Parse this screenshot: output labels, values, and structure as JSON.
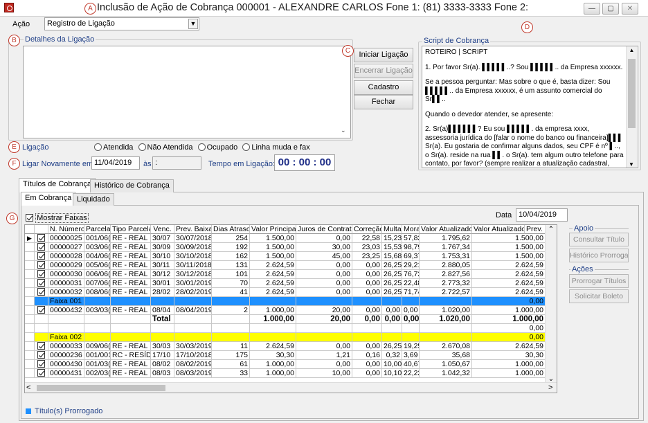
{
  "window": {
    "title": "Inclusão de Ação de Cobrança   000001 - ALEXANDRE CARLOS  Fone 1: (81) 3333-3333 Fone 2:",
    "markers": [
      "A",
      "B",
      "C",
      "D",
      "E",
      "F",
      "G"
    ]
  },
  "acao": {
    "label": "Ação",
    "value": "Registro de Ligação"
  },
  "detalhes": {
    "title": "Detalhes da Ligação",
    "value": ""
  },
  "buttons": {
    "iniciar": "Iniciar Ligação",
    "encerrar": "Encerrar Ligação",
    "cadastro": "Cadastro",
    "fechar": "Fechar"
  },
  "script": {
    "title": "Script de Cobrança",
    "lines": [
      "ROTEIRO | SCRIPT",
      "1. Por favor Sr(a). ▌▌▌▌▌..? Sou ▌▌▌▌▌.. da Empresa xxxxxx.",
      "Se a pessoa perguntar: Mas sobre o que é, basta dizer: Sou ▌▌▌▌▌.. da Empresa xxxxxx, é um assunto comercial do Sr▌▌..",
      "Quando o devedor atender, se apresente:",
      "2. Sr(a)▌▌▌▌▌▌? Eu sou ▌▌▌▌▌. da empresa xxxx, assessoria jurídica do [falar o nome do banco ou financeira]▌▌▌ Sr(a). Eu gostaria de confirmar alguns dados, seu CPF é nº ▌.., o Sr(a). reside na rua ▌▌. o Sr(a). tem algum outro telefone para contato, por favor? (sempre realizar a atualização cadastral, assim, caso precise"
    ]
  },
  "ligacao": {
    "label": "Ligação",
    "options": [
      "Atendida",
      "Não Atendida",
      "Ocupado",
      "Linha muda e fax"
    ],
    "ligar_label": "Ligar Novamente em:",
    "ligar_date": "11/04/2019",
    "as_label": "às",
    "ligar_time": ":",
    "tempo_label": "Tempo em Ligação:",
    "tempo_value": "00 : 00 : 00"
  },
  "tabs": {
    "titulos": "Títulos de Cobrança",
    "historico": "Histórico de Cobrança",
    "em_cobranca": "Em Cobrança",
    "liquidado": "Liquidado"
  },
  "grid": {
    "mostrar_faixas": "Mostrar Faixas",
    "data_label": "Data",
    "data_value": "10/04/2019",
    "columns": [
      "N. Número",
      "Parcela",
      "Tipo Parcela",
      "Venc.",
      "Prev. Baixa",
      "Dias Atraso",
      "Valor Principal",
      "Juros de Contrato",
      "Correção",
      "Multa",
      "Mora",
      "Valor Atualizado",
      "Valor Atualizado(",
      "Prev. Baixa"
    ],
    "rows": [
      {
        "kind": "data",
        "mark": "▶",
        "cells": [
          "00000025",
          "001/06(",
          "RE - REAL",
          "30/07",
          "30/07/2018",
          "254",
          "1.500,00",
          "0,00",
          "22,58",
          "15,23",
          "57,82",
          "1.795,62",
          "1.500,00"
        ]
      },
      {
        "kind": "data",
        "mark": "",
        "cells": [
          "00000027",
          "003/06(",
          "RE - REAL",
          "30/09",
          "30/09/2018",
          "192",
          "1.500,00",
          "30,00",
          "23,03",
          "15,53",
          "98,79",
          "1.767,34",
          "1.500,00"
        ]
      },
      {
        "kind": "data",
        "mark": "",
        "cells": [
          "00000028",
          "004/06(",
          "RE - REAL",
          "30/10",
          "30/10/2018",
          "162",
          "1.500,00",
          "45,00",
          "23,25",
          "15,68",
          "69,37",
          "1.753,31",
          "1.500,00"
        ]
      },
      {
        "kind": "data",
        "mark": "",
        "cells": [
          "00000029",
          "005/06(",
          "RE - REAL",
          "30/11",
          "30/11/2018",
          "131",
          "2.624,59",
          "0,00",
          "0,00",
          "26,25",
          "29,21",
          "2.880,05",
          "2.624,59"
        ]
      },
      {
        "kind": "data",
        "mark": "",
        "cells": [
          "00000030",
          "006/06(",
          "RE - REAL",
          "30/12",
          "30/12/2018",
          "101",
          "2.624,59",
          "0,00",
          "0,00",
          "26,25",
          "76,72",
          "2.827,56",
          "2.624,59"
        ]
      },
      {
        "kind": "data",
        "mark": "",
        "cells": [
          "00000031",
          "007/06(",
          "RE - REAL",
          "30/01",
          "30/01/2019",
          "70",
          "2.624,59",
          "0,00",
          "0,00",
          "26,25",
          "22,48",
          "2.773,32",
          "2.624,59"
        ]
      },
      {
        "kind": "data",
        "mark": "",
        "cells": [
          "00000032",
          "008/06(",
          "RE - REAL",
          "28/02",
          "28/02/2019",
          "41",
          "2.624,59",
          "0,00",
          "0,00",
          "26,25",
          "71,74",
          "2.722,57",
          "2.624,59"
        ]
      },
      {
        "kind": "band",
        "color": "#1e90ff",
        "label": "Faixa 001 d",
        "end": "0,00"
      },
      {
        "kind": "data",
        "mark": "",
        "cells": [
          "00000432",
          "003/03(",
          "RE - REAL",
          "08/04",
          "08/04/2019",
          "2",
          "1.000,00",
          "20,00",
          "0,00",
          "0,00",
          "0,00",
          "1.020,00",
          "1.000,00"
        ]
      },
      {
        "kind": "total",
        "label": "Total",
        "cells": [
          "1.000,00",
          "20,00",
          "0,00",
          "0,00",
          "0,00",
          "1.020,00",
          "1.000,00"
        ]
      },
      {
        "kind": "blank",
        "end": "0,00"
      },
      {
        "kind": "band",
        "color": "#ffff00",
        "label": "Faixa 002 d",
        "end": "0,00"
      },
      {
        "kind": "data",
        "mark": "",
        "cells": [
          "00000033",
          "009/06(",
          "RE - REAL",
          "30/03",
          "30/03/2019",
          "11",
          "2.624,59",
          "0,00",
          "0,00",
          "26,25",
          "19,25",
          "2.670,08",
          "2.624,59"
        ]
      },
      {
        "kind": "data",
        "mark": "",
        "cells": [
          "00000236",
          "001/001",
          "RC - RESÍDU",
          "17/10",
          "17/10/2018",
          "175",
          "30,30",
          "1,21",
          "0,16",
          "0,32",
          "3,69",
          "35,68",
          "30,30"
        ]
      },
      {
        "kind": "data",
        "mark": "",
        "cells": [
          "00000430",
          "001/03(",
          "RE - REAL",
          "08/02",
          "08/02/2019",
          "61",
          "1.000,00",
          "0,00",
          "0,00",
          "10,00",
          "40,67",
          "1.050,67",
          "1.000,00"
        ]
      },
      {
        "kind": "data",
        "mark": "",
        "cells": [
          "00000431",
          "002/03(",
          "RE - REAL",
          "08/03",
          "08/03/2019",
          "33",
          "1.000,00",
          "10,00",
          "0,00",
          "10,10",
          "22,22",
          "1.042,32",
          "1.000,00"
        ]
      }
    ]
  },
  "side": {
    "apoio": "Apoio",
    "consultar": "Consultar Título",
    "historico_prorrog": "Histórico Prorrogaç",
    "acoes": "Ações",
    "prorrogar": "Prorrogar Títulos",
    "solicitar": "Solicitar Boleto"
  },
  "footer": {
    "legend": "Título(s) Prorrogado"
  }
}
